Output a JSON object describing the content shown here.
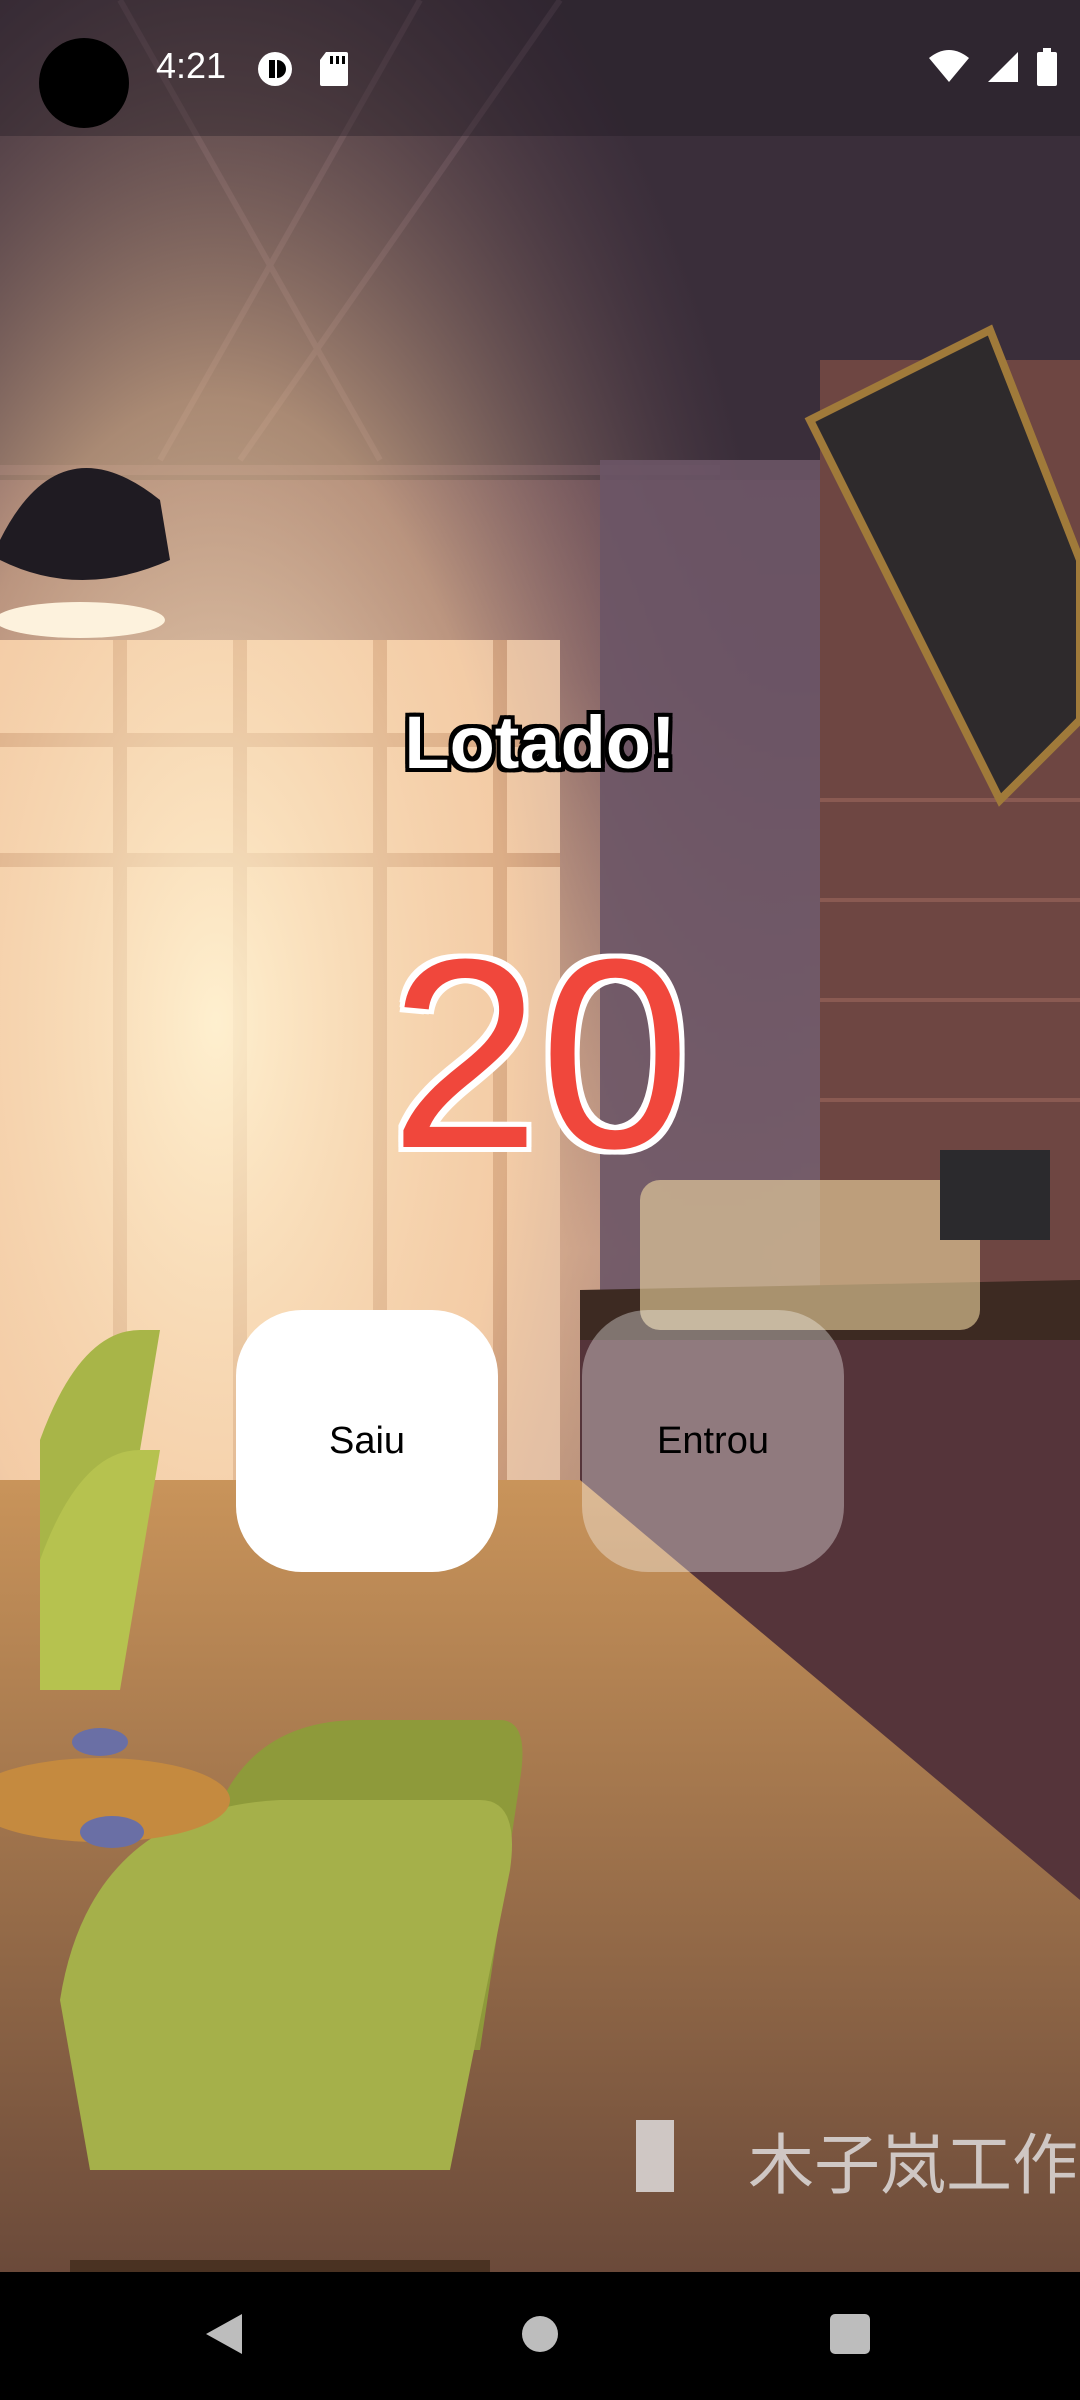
{
  "status_bar": {
    "time": "4:21",
    "left_icons": [
      "camera-dot",
      "privacy-icon",
      "sd-card-icon"
    ],
    "right_icons": [
      "wifi-icon",
      "signal-icon",
      "battery-icon"
    ]
  },
  "main": {
    "title": "Lotado!",
    "count": "20",
    "buttons": {
      "left_label": "Saiu",
      "right_label": "Entrou"
    }
  },
  "background": {
    "watermark": "木子岚工作"
  },
  "nav_bar": {
    "buttons": [
      "back",
      "home",
      "recents"
    ]
  },
  "colors": {
    "count_color": "#f0473c",
    "title_color": "#ffffff"
  }
}
